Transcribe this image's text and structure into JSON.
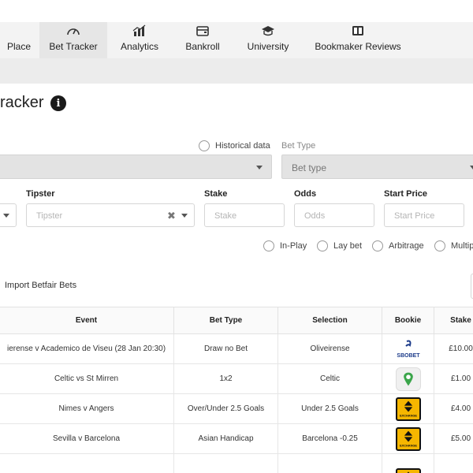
{
  "nav": {
    "tabs": [
      {
        "label": "Place",
        "icon": "none",
        "active": false
      },
      {
        "label": "Bet Tracker",
        "icon": "gauge-icon",
        "active": true
      },
      {
        "label": "Analytics",
        "icon": "bar-chart-icon",
        "active": false
      },
      {
        "label": "Bankroll",
        "icon": "wallet-icon",
        "active": false
      },
      {
        "label": "University",
        "icon": "graduation-cap-icon",
        "active": false
      },
      {
        "label": "Bookmaker Reviews",
        "icon": "book-icon",
        "active": false
      }
    ]
  },
  "page": {
    "title": "racker",
    "info_icon_glyph": "i"
  },
  "filters": {
    "historical_label": "Historical data",
    "bet_type_label": "Bet Type",
    "bet_type_placeholder": "Bet type"
  },
  "form": {
    "tipster_label": "Tipster",
    "tipster_placeholder": "Tipster",
    "stake_label": "Stake",
    "stake_placeholder": "Stake",
    "odds_label": "Odds",
    "odds_placeholder": "Odds",
    "start_price_label": "Start Price",
    "start_price_placeholder": "Start Price",
    "clear_glyph": "✖"
  },
  "options": {
    "in_play": "In-Play",
    "lay_bet": "Lay bet",
    "arbitrage": "Arbitrage",
    "multiple": "Multip"
  },
  "actions": {
    "import_betfair": "Import Betfair Bets"
  },
  "table": {
    "headers": {
      "event": "Event",
      "bet_type": "Bet Type",
      "selection": "Selection",
      "bookie": "Bookie",
      "stake": "Stake"
    },
    "rows": [
      {
        "event": "ierense v Academico de Viseu (28 Jan 20:30)",
        "bet_type": "Draw no Bet",
        "selection": "Oliveirense",
        "bookie": "sbobet",
        "stake": "£10.00"
      },
      {
        "event": "Celtic vs St Mirren",
        "bet_type": "1x2",
        "selection": "Celtic",
        "bookie": "green-marker",
        "stake": "£1.00"
      },
      {
        "event": "Nimes v Angers",
        "bet_type": "Over/Under 2.5 Goals",
        "selection": "Under 2.5 Goals",
        "bookie": "betfair-exchange",
        "stake": "£4.00"
      },
      {
        "event": "Sevilla v Barcelona",
        "bet_type": "Asian Handicap",
        "selection": "Barcelona -0.25",
        "bookie": "betfair-exchange",
        "stake": "£5.00"
      },
      {
        "event": "",
        "bet_type": "",
        "selection": "",
        "bookie": "betfair-exchange",
        "stake": ""
      }
    ],
    "bookie_logo_text": {
      "sbobet": "SBOBET",
      "betfair": "EXCHANGE"
    }
  }
}
